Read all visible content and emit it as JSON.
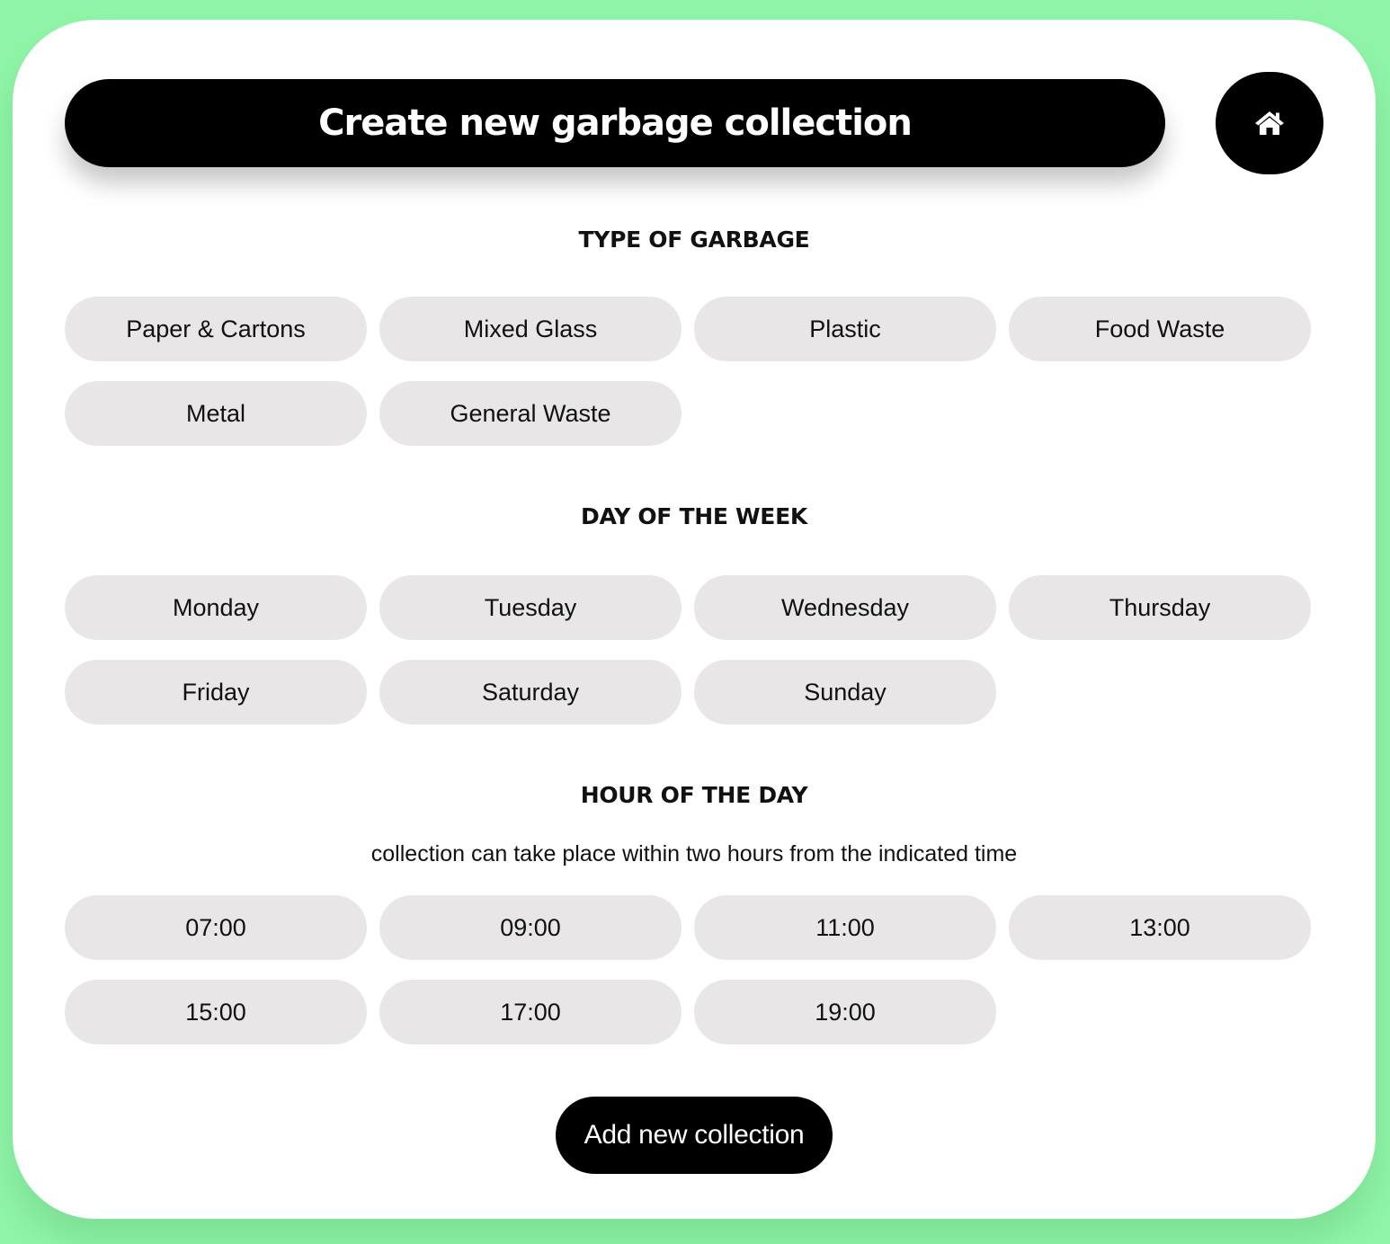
{
  "header": {
    "title": "Create new garbage collection",
    "home_icon": "home-icon"
  },
  "garbage_section": {
    "title": "TYPE OF GARBAGE",
    "options": [
      "Paper & Cartons",
      "Mixed Glass",
      "Plastic",
      "Food Waste",
      "Metal",
      "General Waste"
    ]
  },
  "day_section": {
    "title": "DAY OF THE WEEK",
    "options": [
      "Monday",
      "Tuesday",
      "Wednesday",
      "Thursday",
      "Friday",
      "Saturday",
      "Sunday"
    ]
  },
  "hour_section": {
    "title": "HOUR OF THE DAY",
    "note": "collection can take place within two hours from the indicated time",
    "options": [
      "07:00",
      "09:00",
      "11:00",
      "13:00",
      "15:00",
      "17:00",
      "19:00"
    ]
  },
  "add_button_label": "Add new collection",
  "colors": {
    "background": "#90f5a8",
    "card": "#ffffff",
    "pill": "#e8e6e7",
    "primary": "#000000"
  }
}
